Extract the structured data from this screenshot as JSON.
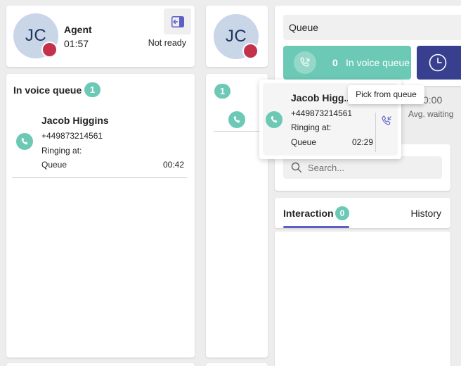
{
  "agent": {
    "initials": "JC",
    "label": "Agent",
    "timer": "01:57",
    "status": "Not ready"
  },
  "voice_queue_panel": {
    "title": "In voice queue",
    "count": "1",
    "item": {
      "name": "Jacob Higgins",
      "phone": "+449873214561",
      "ringing_label": "Ringing at:",
      "queue_name": "Queue",
      "duration": "00:42"
    }
  },
  "middle_column": {
    "initials": "JC",
    "count": "1"
  },
  "popup_card": {
    "name": "Jacob Higg...",
    "phone": "+449873214561",
    "ringing_label": "Ringing at:",
    "queue_name": "Queue",
    "duration": "02:29"
  },
  "tooltip": {
    "text": "Pick from queue"
  },
  "right_panel": {
    "queue_label": "Queue",
    "in_voice_queue_count": "0",
    "in_voice_queue_label": "In voice queue",
    "avg_waiting_value": "0:00",
    "avg_waiting_label": "Avg. waiting",
    "search_placeholder": "Search...",
    "tab_interaction_label": "Interaction",
    "tab_interaction_count": "0",
    "tab_history_label": "History"
  },
  "colors": {
    "accent_teal": "#6cc9b6",
    "indigo": "#383f8f",
    "presence_busy": "#c4314b",
    "tab_underline": "#5b5fc7"
  }
}
